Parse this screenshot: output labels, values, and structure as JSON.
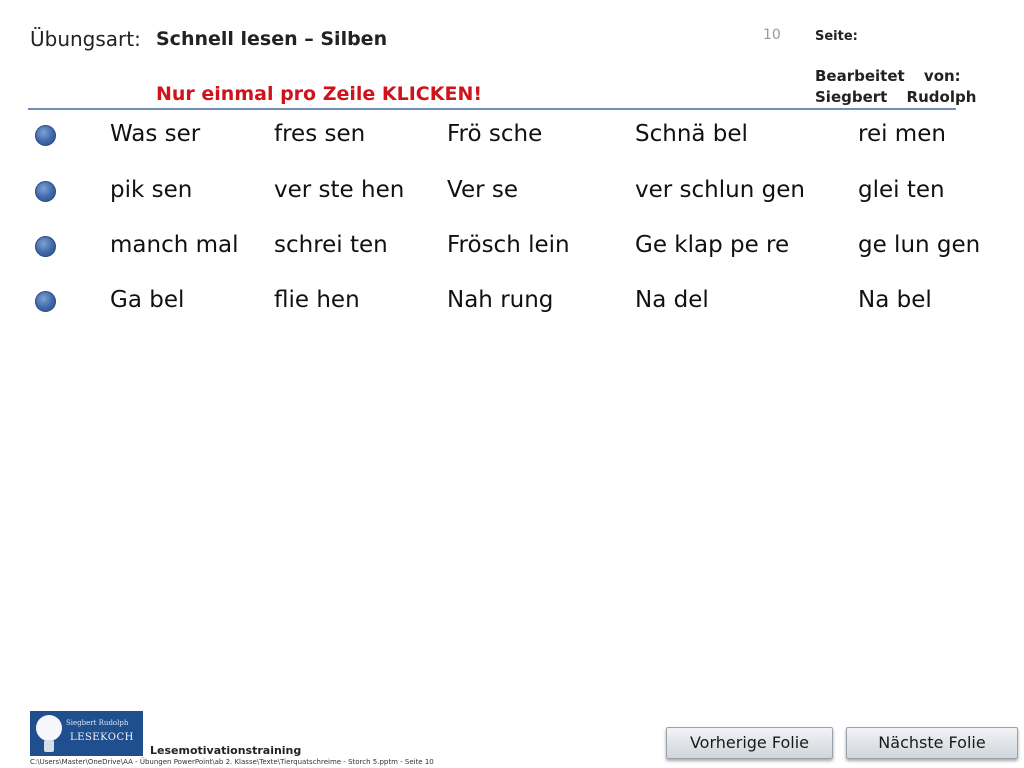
{
  "header": {
    "exercise_label": "Übungsart:",
    "exercise_title": "Schnell lesen – Silben",
    "instruction": "Nur einmal pro Zeile KLICKEN!",
    "page_number": "10",
    "page_label": "Seite:",
    "editor_label": "Bearbeitet von:",
    "editor_name": "Siegbert Rudolph"
  },
  "rows": [
    {
      "words": [
        "Was ser",
        "fres sen",
        "Frö sche",
        "Schnä bel",
        "rei men"
      ]
    },
    {
      "words": [
        "pik sen",
        "ver ste hen",
        "Ver se",
        "ver schlun gen",
        "glei ten"
      ]
    },
    {
      "words": [
        "manch mal",
        "schrei ten",
        "Frösch lein",
        "Ge klap pe re",
        "ge lun gen"
      ]
    },
    {
      "words": [
        "Ga bel",
        "flie hen",
        "Nah rung",
        "Na del",
        "Na bel"
      ]
    }
  ],
  "colors": {
    "accent_rule": "#6f8fb5",
    "instruction_red": "#d0121b",
    "bullet_blue": "#3e67a8"
  },
  "logo": {
    "name": "Siegbert Rudolph",
    "brand": "LESEKOCH",
    "icon": "lightbulb-chef-icon"
  },
  "footer": {
    "label": "Lesemotivationstraining",
    "path": "C:\\Users\\Master\\OneDrive\\AA - Übungen PowerPoint\\ab 2. Klasse\\Texte\\Tierquatschreime - Storch 5.pptm - Seite 10"
  },
  "nav": {
    "prev_label": "Vorherige Folie",
    "next_label": "Nächste Folie"
  }
}
